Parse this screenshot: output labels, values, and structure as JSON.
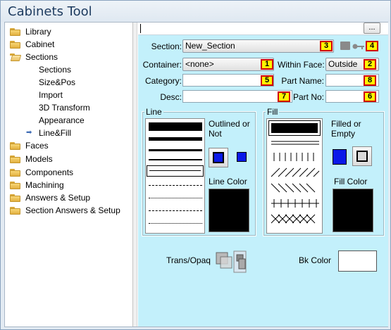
{
  "window": {
    "title": "Cabinets Tool"
  },
  "tree": {
    "items": [
      {
        "label": "Library",
        "kind": "folder",
        "level": 0
      },
      {
        "label": "Cabinet",
        "kind": "folder",
        "level": 0
      },
      {
        "label": "Sections",
        "kind": "folder-open",
        "level": 0
      },
      {
        "label": "Sections",
        "kind": "leaf",
        "level": 1
      },
      {
        "label": "Size&Pos",
        "kind": "leaf",
        "level": 1
      },
      {
        "label": "Import",
        "kind": "leaf",
        "level": 1
      },
      {
        "label": "3D Transform",
        "kind": "leaf",
        "level": 1
      },
      {
        "label": "Appearance",
        "kind": "leaf",
        "level": 1
      },
      {
        "label": "Line&Fill",
        "kind": "selected-leaf",
        "level": 1
      },
      {
        "label": "Faces",
        "kind": "folder",
        "level": 0
      },
      {
        "label": "Models",
        "kind": "folder",
        "level": 0
      },
      {
        "label": "Components",
        "kind": "folder",
        "level": 0
      },
      {
        "label": "Machining",
        "kind": "folder",
        "level": 0
      },
      {
        "label": "Answers & Setup",
        "kind": "folder",
        "level": 0
      },
      {
        "label": "Section Answers & Setup",
        "kind": "folder",
        "level": 0
      }
    ]
  },
  "topbar": {
    "browse_label": "..."
  },
  "form": {
    "section_label": "Section:",
    "section_value": "New_Section",
    "container_label": "Container:",
    "container_value": "<none>",
    "within_face_label": "Within Face:",
    "within_face_value": "Outside",
    "category_label": "Category:",
    "category_value": "",
    "part_name_label": "Part Name:",
    "part_name_value": "",
    "desc_label": "Desc:",
    "desc_value": "",
    "part_no_label": "Part No:",
    "part_no_value": ""
  },
  "badges": {
    "b1": "1",
    "b2": "2",
    "b3": "3",
    "b4": "4",
    "b5": "5",
    "b6": "6",
    "b7": "7",
    "b8": "8"
  },
  "line_group": {
    "title": "Line",
    "outlined_label": "Outlined or Not",
    "line_color_label": "Line Color",
    "line_color": "#000000"
  },
  "fill_group": {
    "title": "Fill",
    "filled_label": "Filled or Empty",
    "fill_color_label": "Fill Color",
    "fill_color": "#000000"
  },
  "bottom": {
    "trans_label": "Trans/Opaq",
    "bk_color_label": "Bk Color",
    "bk_color": "#ffffff"
  },
  "colors": {
    "panel_bg": "#c3f0fb",
    "badge_fill": "#fff500",
    "badge_border": "#d00000",
    "accent_blue": "#0a18e8"
  }
}
